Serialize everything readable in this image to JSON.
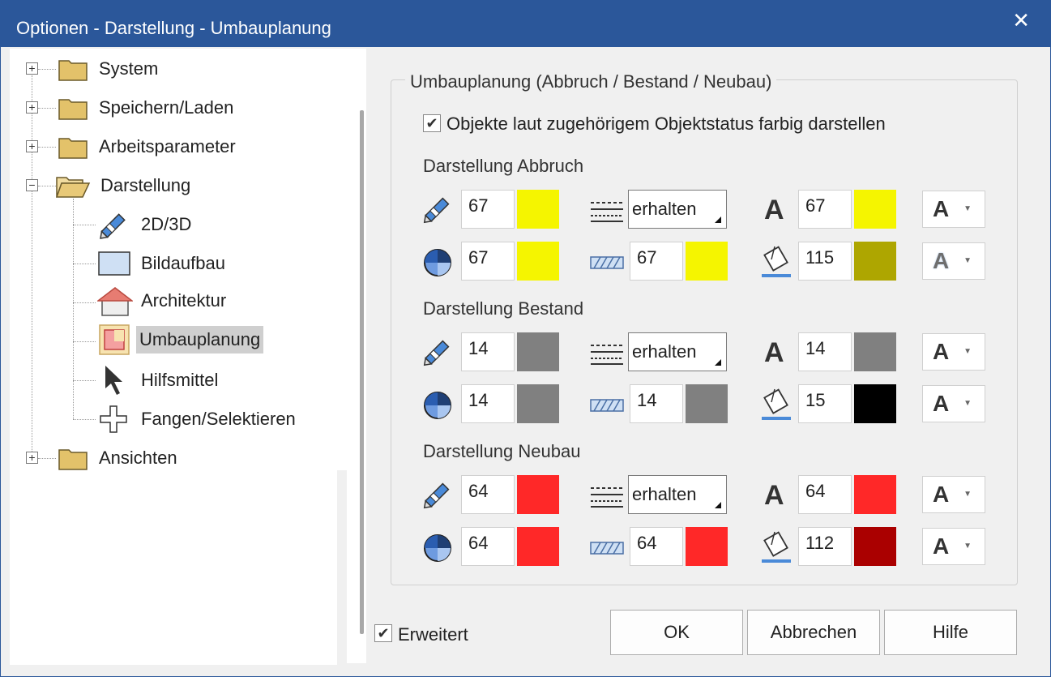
{
  "window": {
    "title": "Optionen - Darstellung - Umbauplanung",
    "close_glyph": "✕"
  },
  "tree": {
    "items": [
      {
        "label": "System",
        "icon": "folder-icon",
        "expander": "+"
      },
      {
        "label": "Speichern/Laden",
        "icon": "folder-icon",
        "expander": "+"
      },
      {
        "label": "Arbeitsparameter",
        "icon": "folder-icon",
        "expander": "+"
      },
      {
        "label": "Darstellung",
        "icon": "folder-open-icon",
        "expander": "−"
      },
      {
        "label": "2D/3D",
        "icon": "pencil-icon"
      },
      {
        "label": "Bildaufbau",
        "icon": "screen-layout-icon"
      },
      {
        "label": "Architektur",
        "icon": "house-icon"
      },
      {
        "label": "Umbauplanung",
        "icon": "renovation-icon",
        "selected": true
      },
      {
        "label": "Hilfsmittel",
        "icon": "cursor-arrow-icon"
      },
      {
        "label": "Fangen/Selektieren",
        "icon": "crosshair-icon"
      },
      {
        "label": "Ansichten",
        "icon": "folder-icon",
        "expander": "+"
      }
    ]
  },
  "group": {
    "title": "Umbauplanung (Abbruch / Bestand / Neubau)",
    "status_checkbox": {
      "label": "Objekte laut zugehörigem Objektstatus farbig darstellen",
      "checked": true,
      "glyph": "✔"
    },
    "sections": [
      {
        "title": "Darstellung Abbruch",
        "pen": "67",
        "pen_color": "#f5f500",
        "line_combo": "erhalten",
        "text_color_num": "67",
        "text_color": "#f5f500",
        "fill": "67",
        "fill_color": "#f5f500",
        "hatch": "67",
        "hatch_color": "#f5f500",
        "bucket": "115",
        "bucket_color": "#aea600",
        "font_btn_1": "A",
        "font_btn_2": "A"
      },
      {
        "title": "Darstellung Bestand",
        "pen": "14",
        "pen_color": "#808080",
        "line_combo": "erhalten",
        "text_color_num": "14",
        "text_color": "#808080",
        "fill": "14",
        "fill_color": "#808080",
        "hatch": "14",
        "hatch_color": "#808080",
        "bucket": "15",
        "bucket_color": "#000000",
        "font_btn_1": "A",
        "font_btn_2": "A"
      },
      {
        "title": "Darstellung Neubau",
        "pen": "64",
        "pen_color": "#ff2828",
        "line_combo": "erhalten",
        "text_color_num": "64",
        "text_color": "#ff2828",
        "fill": "64",
        "fill_color": "#ff2828",
        "hatch": "64",
        "hatch_color": "#ff2828",
        "bucket": "112",
        "bucket_color": "#aa0000",
        "font_btn_1": "A",
        "font_btn_2": "A"
      }
    ]
  },
  "footer": {
    "extended_checkbox": {
      "label": "Erweitert",
      "checked": true,
      "glyph": "✔"
    },
    "ok": "OK",
    "cancel": "Abbrechen",
    "help": "Hilfe",
    "dropdown_glyph": "▼"
  }
}
